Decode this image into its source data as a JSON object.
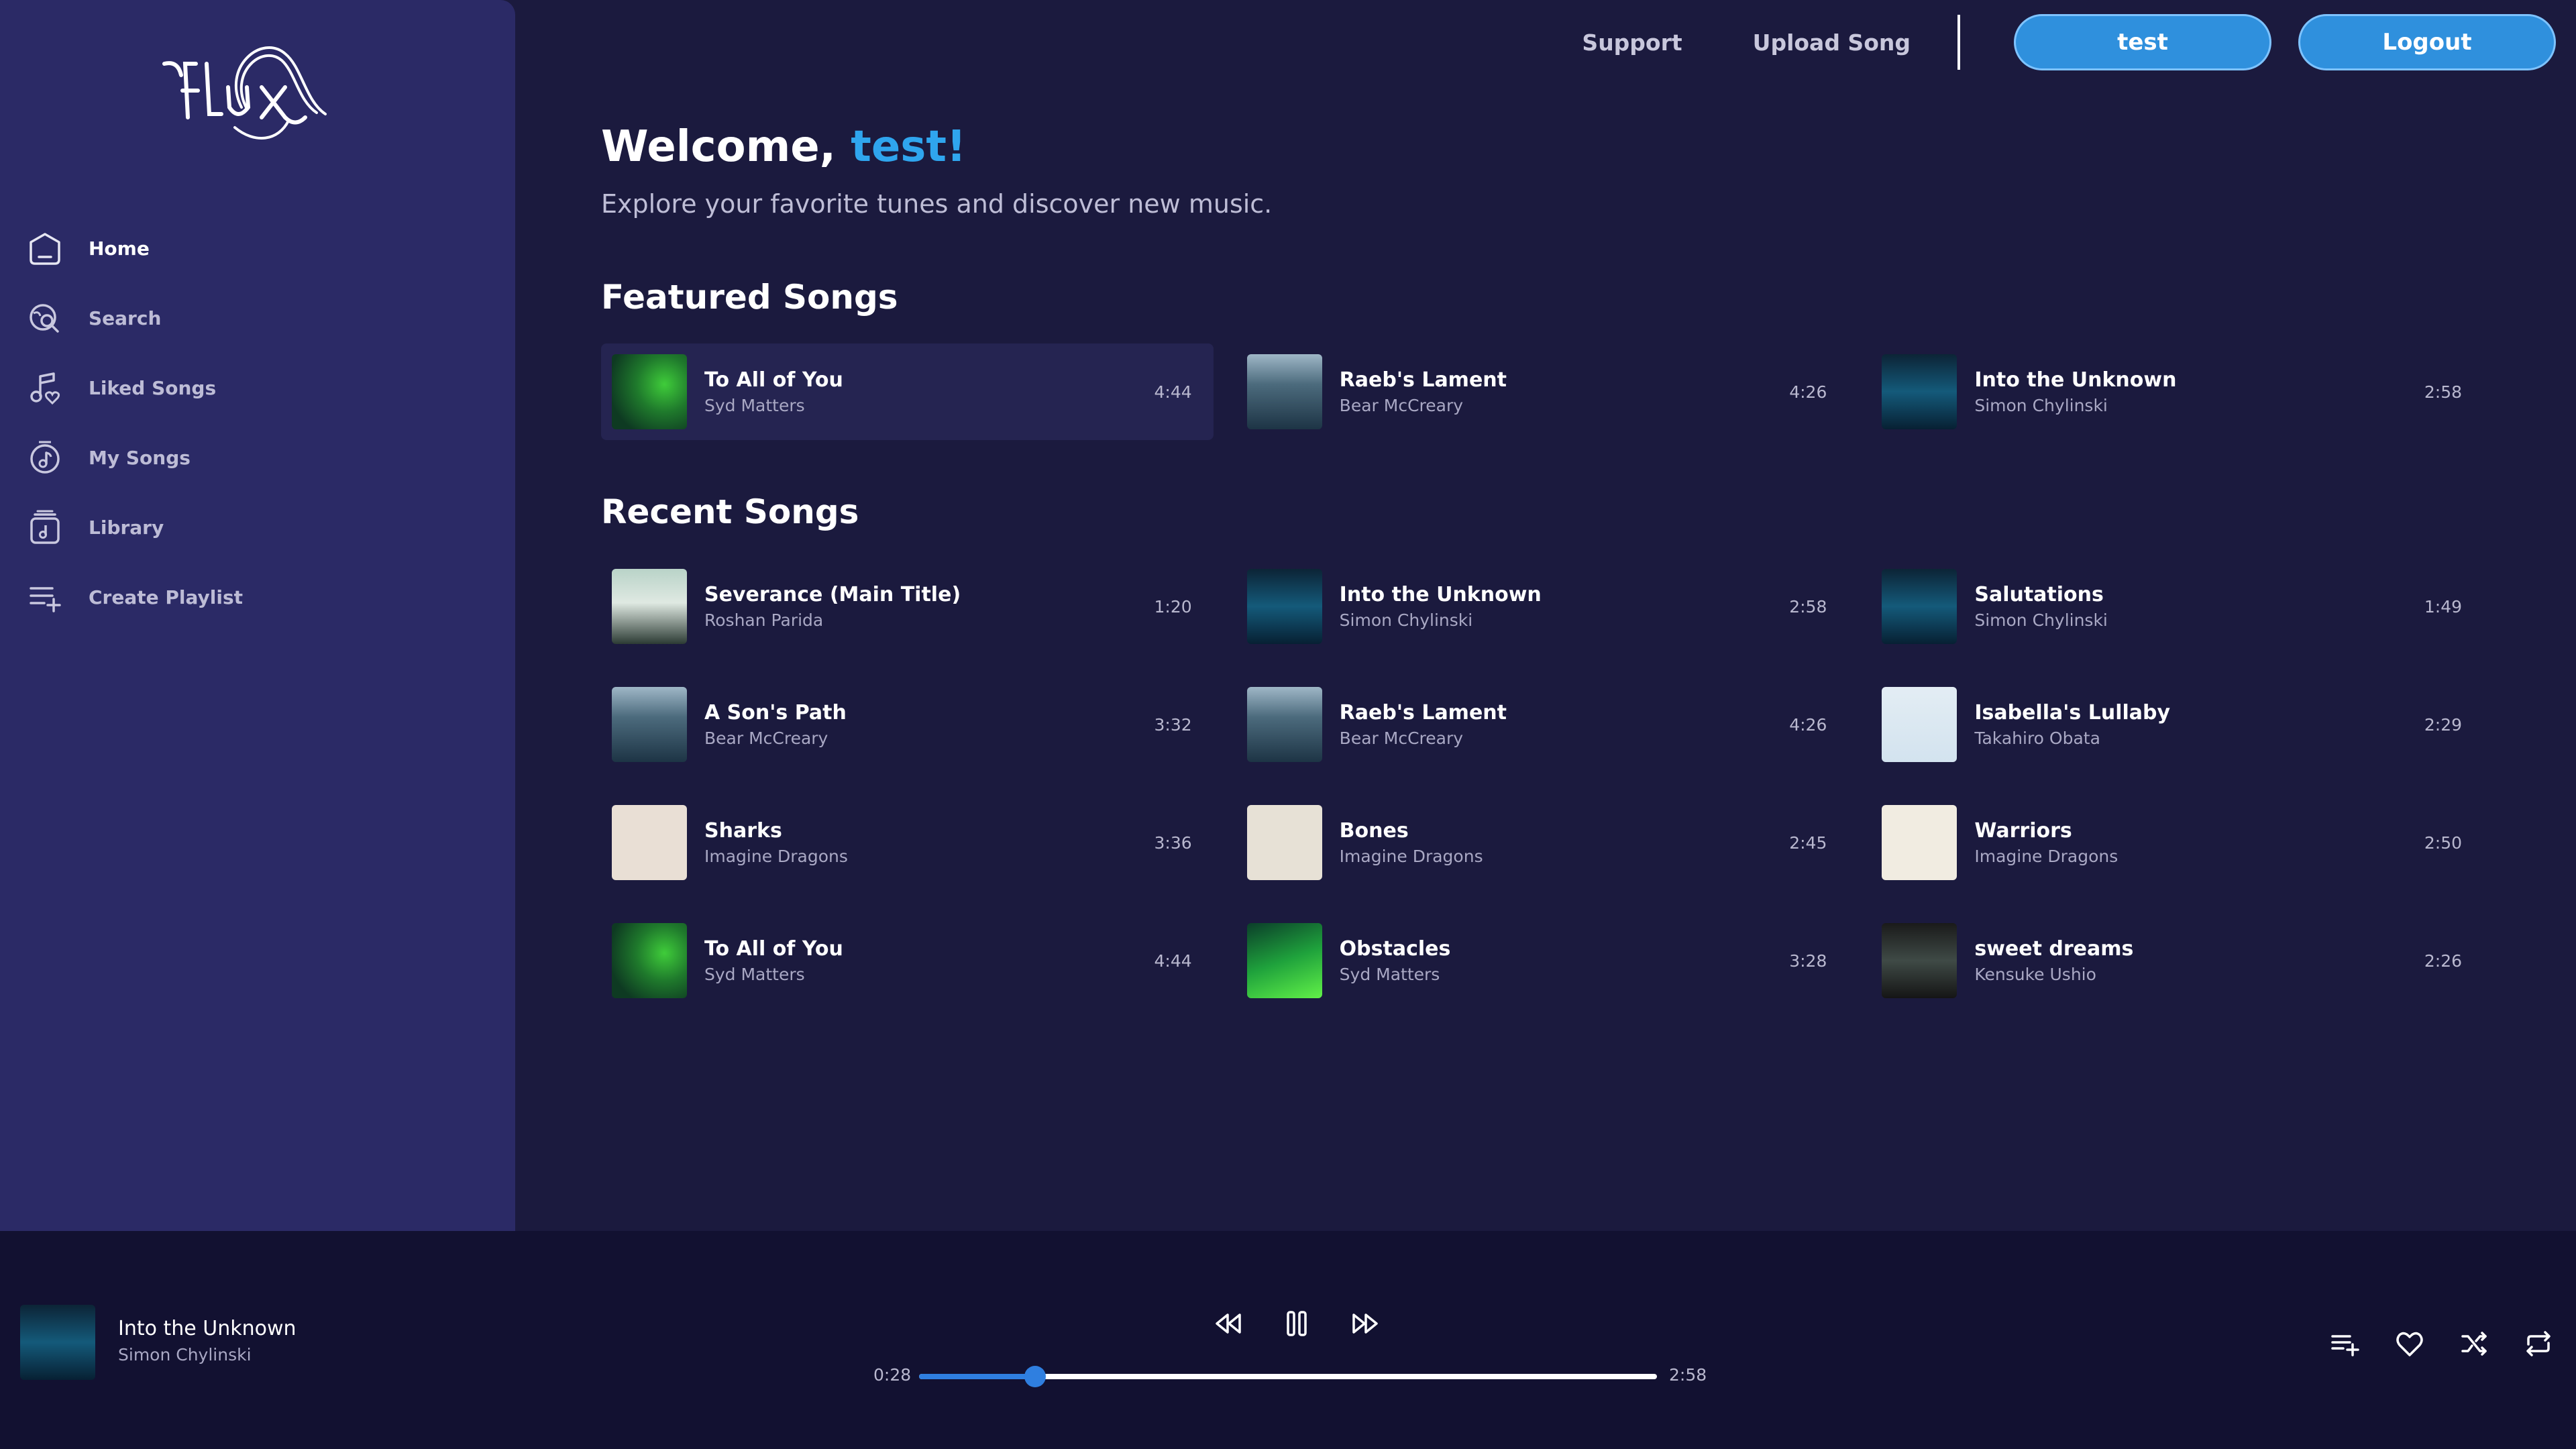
{
  "app": {
    "brand": "Flux"
  },
  "sidebar": {
    "items": [
      {
        "label": "Home",
        "icon": "home-icon"
      },
      {
        "label": "Search",
        "icon": "search-icon"
      },
      {
        "label": "Liked Songs",
        "icon": "liked-songs-icon"
      },
      {
        "label": "My Songs",
        "icon": "my-songs-icon"
      },
      {
        "label": "Library",
        "icon": "library-icon"
      },
      {
        "label": "Create Playlist",
        "icon": "create-playlist-icon"
      }
    ]
  },
  "header": {
    "support": "Support",
    "upload": "Upload Song",
    "user_button": "test",
    "logout_button": "Logout"
  },
  "main": {
    "welcome_prefix": "Welcome, ",
    "welcome_user": "test!",
    "subtitle": "Explore your favorite tunes and discover new music.",
    "featured_title": "Featured Songs",
    "recent_title": "Recent Songs",
    "featured": [
      {
        "title": "To All of You",
        "artist": "Syd Matters",
        "duration": "4:44",
        "cover": "green"
      },
      {
        "title": "Raeb's Lament",
        "artist": "Bear McCreary",
        "duration": "4:26",
        "cover": "gow"
      },
      {
        "title": "Into the Unknown",
        "artist": "Simon Chylinski",
        "duration": "2:58",
        "cover": "sub"
      }
    ],
    "recent": [
      {
        "title": "Severance (Main Title)",
        "artist": "Roshan Parida",
        "duration": "1:20",
        "cover": "sev"
      },
      {
        "title": "Into the Unknown",
        "artist": "Simon Chylinski",
        "duration": "2:58",
        "cover": "sub"
      },
      {
        "title": "Salutations",
        "artist": "Simon Chylinski",
        "duration": "1:49",
        "cover": "sub"
      },
      {
        "title": "A Son's Path",
        "artist": "Bear McCreary",
        "duration": "3:32",
        "cover": "gow"
      },
      {
        "title": "Raeb's Lament",
        "artist": "Bear McCreary",
        "duration": "4:26",
        "cover": "gow"
      },
      {
        "title": "Isabella's Lullaby",
        "artist": "Takahiro Obata",
        "duration": "2:29",
        "cover": "isabella"
      },
      {
        "title": "Sharks",
        "artist": "Imagine Dragons",
        "duration": "3:36",
        "cover": "shark"
      },
      {
        "title": "Bones",
        "artist": "Imagine Dragons",
        "duration": "2:45",
        "cover": "bones"
      },
      {
        "title": "Warriors",
        "artist": "Imagine Dragons",
        "duration": "2:50",
        "cover": "warriors"
      },
      {
        "title": "To All of You",
        "artist": "Syd Matters",
        "duration": "4:44",
        "cover": "green"
      },
      {
        "title": "Obstacles",
        "artist": "Syd Matters",
        "duration": "3:28",
        "cover": "green2"
      },
      {
        "title": "sweet dreams",
        "artist": "Kensuke Ushio",
        "duration": "2:26",
        "cover": "chainsaw"
      }
    ]
  },
  "player": {
    "title": "Into the Unknown",
    "artist": "Simon Chylinski",
    "elapsed": "0:28",
    "total": "2:58",
    "progress_fraction": 0.157
  },
  "colors": {
    "accent": "#2fa5ee",
    "sidebar_bg": "#2b2a66",
    "main_bg": "#1b1a3e",
    "player_bg": "#121131",
    "button_bg": "#2f90dd",
    "progress": "#2f7fe0"
  }
}
